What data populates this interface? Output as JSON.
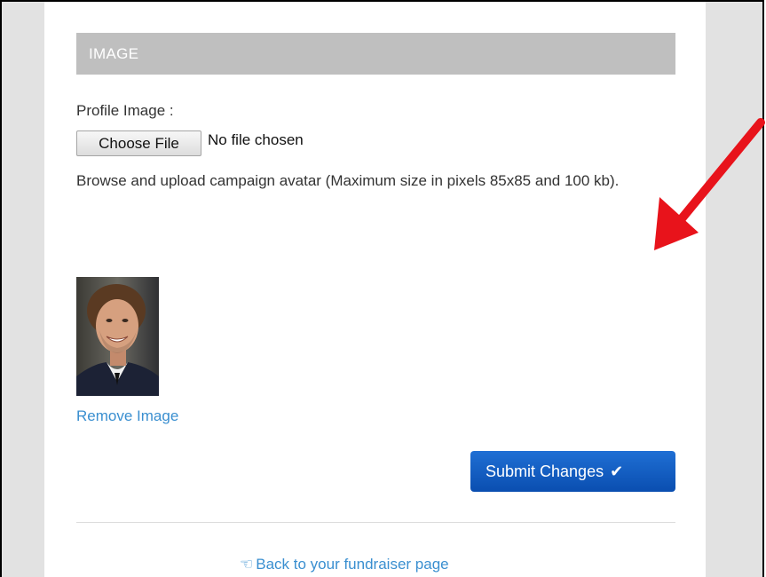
{
  "section": {
    "title": "IMAGE"
  },
  "profile_image": {
    "label": "Profile Image :",
    "choose_button": "Choose File",
    "file_status": "No file chosen",
    "help_text": "Browse and upload campaign avatar (Maximum size in pixels 85x85 and 100 kb).",
    "remove_link": "Remove Image"
  },
  "actions": {
    "submit_label": "Submit Changes",
    "submit_icon": "checkmark-icon"
  },
  "footer": {
    "back_icon": "pointing-hand-icon",
    "back_label": "Back to your fundraiser page"
  },
  "colors": {
    "header_bg": "#bfbfbf",
    "link": "#3a8fd0",
    "primary_button": "#1560c4",
    "annotation_arrow": "#e8131b"
  }
}
